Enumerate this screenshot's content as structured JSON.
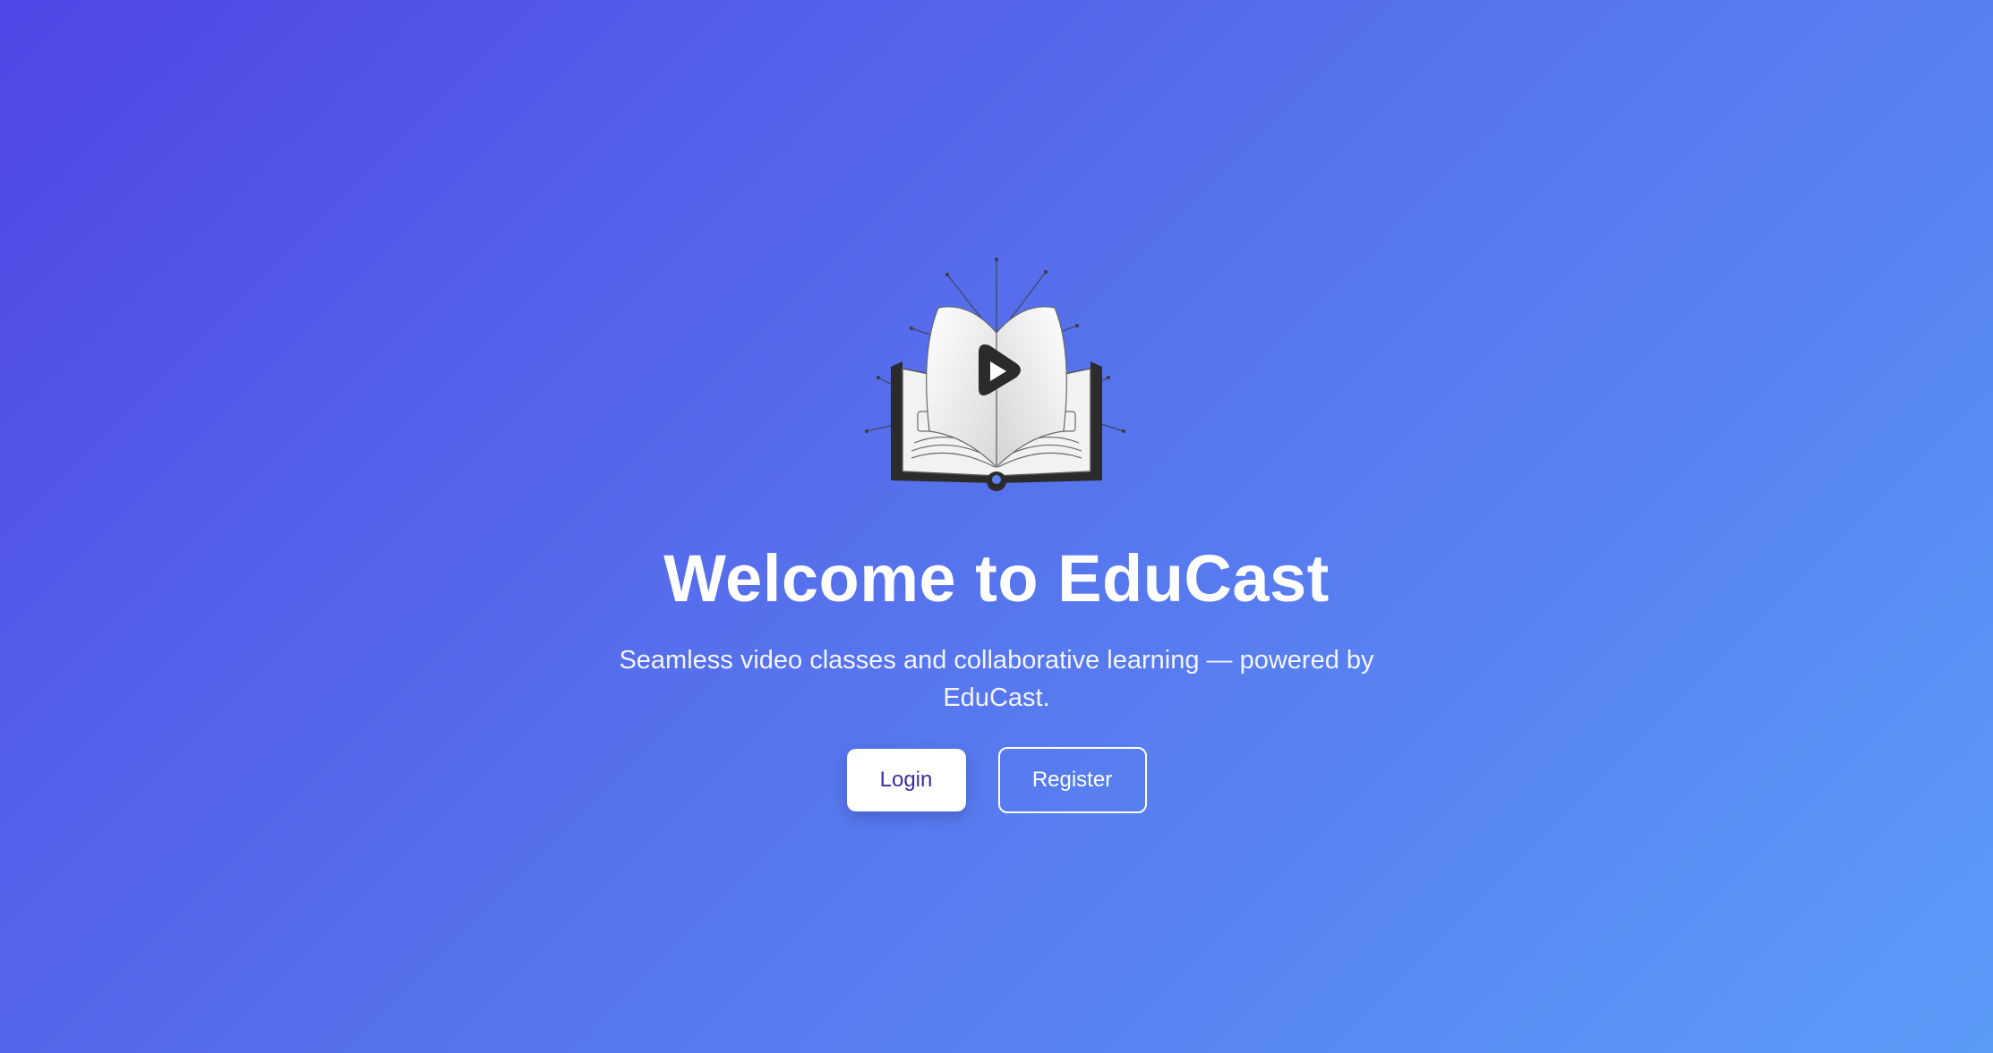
{
  "hero": {
    "logo_icon": "open-book-play-icon",
    "title": "Welcome to EduCast",
    "subtitle": "Seamless video classes and collaborative learning — powered by EduCast."
  },
  "actions": {
    "login_label": "Login",
    "register_label": "Register"
  },
  "colors": {
    "gradient_start": "#4f46e5",
    "gradient_end": "#5b9cf8",
    "login_text": "#3730a3"
  }
}
